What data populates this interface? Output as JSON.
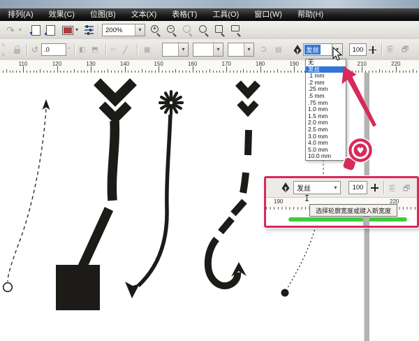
{
  "colors": {
    "accent_blue": "#2f76d8",
    "annotation_pink": "#d8295b",
    "underline_green": "#3ecb3e",
    "guide_gray": "#b3b3b3",
    "shape_black": "#1d1b18"
  },
  "menu": {
    "items": [
      "排列(A)",
      "效果(C)",
      "位图(B)",
      "文本(X)",
      "表格(T)",
      "工具(O)",
      "窗口(W)",
      "帮助(H)"
    ]
  },
  "toolbar": {
    "zoom_level": "200%"
  },
  "icons": {
    "redo": "↷",
    "caret_down": "▾",
    "import_arrow": "▾",
    "export_arrow": "▴",
    "plus": "+",
    "minus": "−",
    "heart": "♥",
    "degree": "°"
  },
  "property_bar": {
    "rotation_value": ".0",
    "outline_width_value": "发丝",
    "outline_scale_value": "100"
  },
  "ruler": {
    "numbers": [
      110,
      120,
      130,
      140,
      150,
      160,
      170,
      180,
      190,
      210,
      220
    ]
  },
  "dropdown": {
    "items": [
      "无",
      "发丝",
      ".1 mm",
      ".2 mm",
      ".25 mm",
      ".5 mm",
      ".75 mm",
      "1.0 mm",
      "1.5 mm",
      "2.0 mm",
      "2.5 mm",
      "3.0 mm",
      "4.0 mm",
      "5.0 mm",
      "10.0 mm"
    ],
    "selected_index": 1
  },
  "inset": {
    "outline_width_value": "发丝",
    "outline_scale_value": "100",
    "tooltip": "选择轮廓宽度或键入新宽度",
    "ruler_left_number": "190",
    "ruler_right_number": "220"
  }
}
